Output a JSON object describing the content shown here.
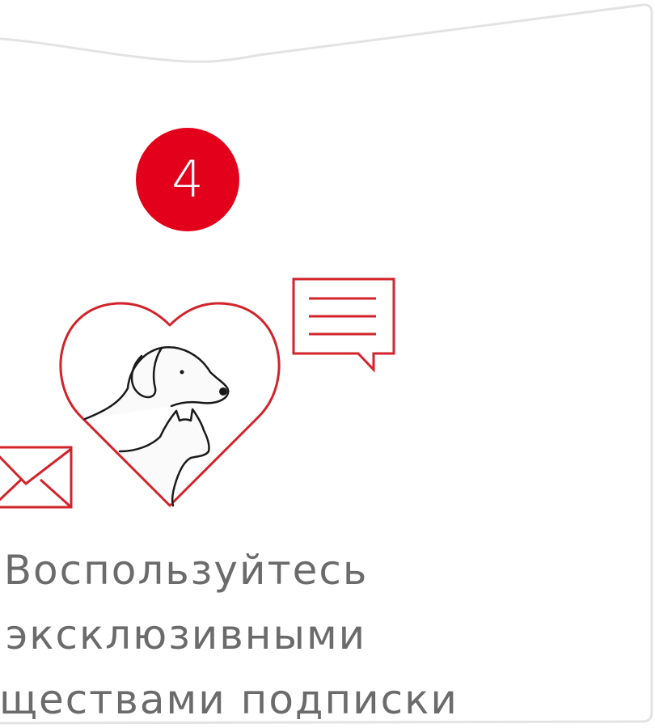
{
  "step": {
    "number": "4",
    "text_lines": [
      "Воспользуйтесь",
      "эксклюзивными",
      "имуществами подписки"
    ]
  },
  "colors": {
    "accent": "#e2001a",
    "icon_red": "#d2232a",
    "text": "#6b6b6b",
    "border": "#e3e3e3"
  },
  "icons": {
    "heart": "heart-pets-icon",
    "envelope": "envelope-icon",
    "chat": "chat-bubble-icon"
  }
}
